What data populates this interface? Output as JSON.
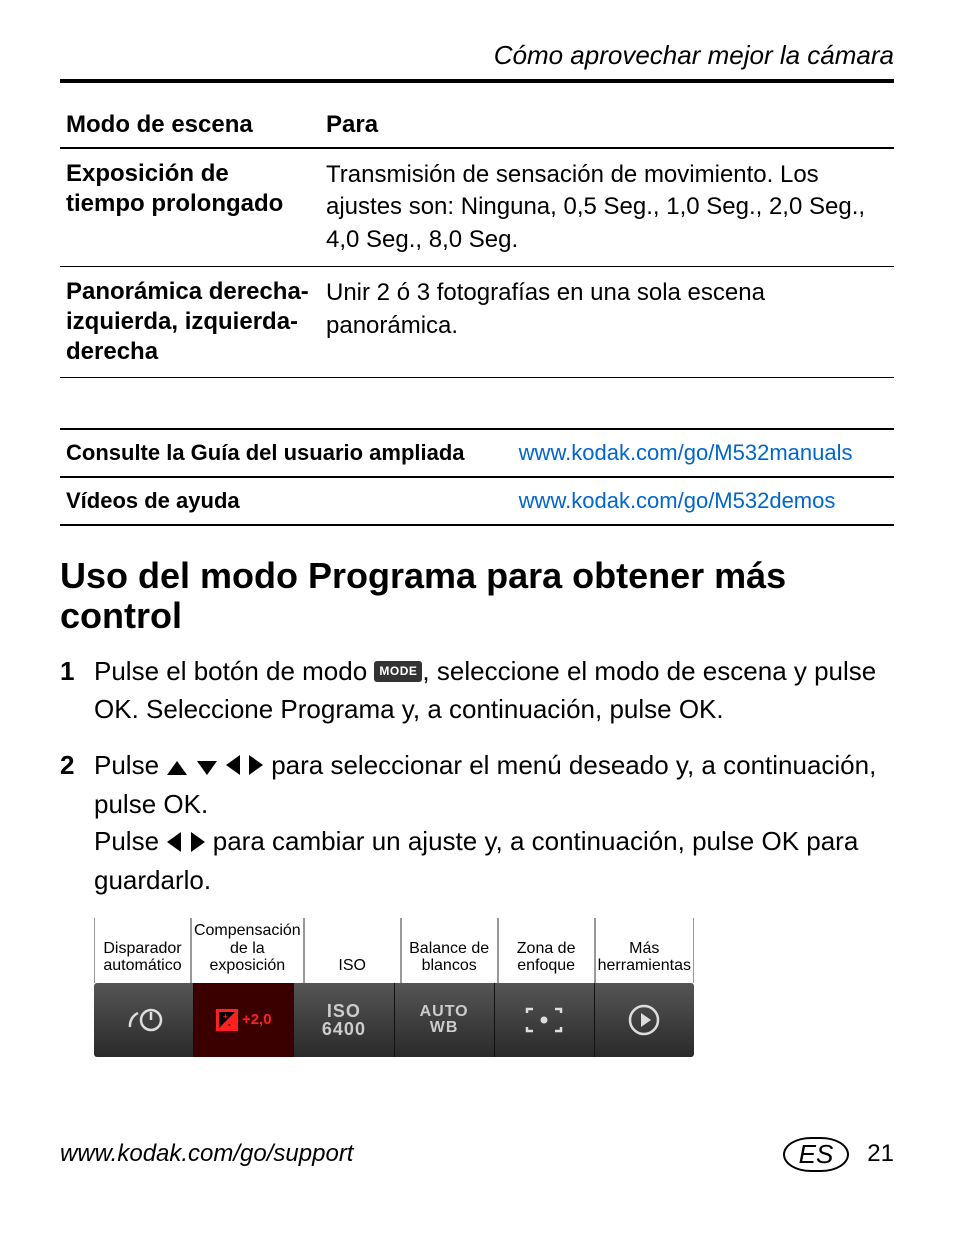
{
  "header": {
    "running_head": "Cómo aprovechar mejor la cámara"
  },
  "scene_table": {
    "col1": "Modo de escena",
    "col2": "Para",
    "rows": [
      {
        "mode": "Exposición de tiempo prolongado",
        "desc": "Transmisión de sensación de movimiento. Los ajustes son: Ninguna, 0,5 Seg., 1,0 Seg., 2,0 Seg., 4,0 Seg., 8,0 Seg."
      },
      {
        "mode": "Panorámica derecha-izquierda, izquierda-derecha",
        "desc": "Unir 2 ó 3 fotografías en una sola escena panorámica."
      }
    ]
  },
  "links_table": {
    "rows": [
      {
        "label": "Consulte la Guía del usuario ampliada",
        "url": "www.kodak.com/go/M532manuals"
      },
      {
        "label": "Vídeos de ayuda",
        "url": "www.kodak.com/go/M532demos"
      }
    ]
  },
  "section_title": "Uso del modo Programa para obtener más control",
  "steps": {
    "s1_a": "Pulse el botón de modo ",
    "s1_mode_badge": "MODE",
    "s1_b": ", seleccione el modo de escena y pulse OK. Seleccione Programa y, a continuación, pulse OK.",
    "s2_a": "Pulse ",
    "s2_b": " para seleccionar el menú deseado y, a continuación, pulse OK.",
    "s2_c": "Pulse ",
    "s2_d": " para cambiar un ajuste y, a continuación, pulse OK para guardarlo."
  },
  "toolbar": {
    "labels": [
      "Disparador automático",
      "Compensación de la exposición",
      "ISO",
      "Balance de blancos",
      "Zona de enfoque",
      "Más herramientas"
    ],
    "exp_value": "+2,0",
    "iso_line1": "ISO",
    "iso_line2": "6400",
    "wb_line1": "AUTO",
    "wb_line2": "WB"
  },
  "footer": {
    "url": "www.kodak.com/go/support",
    "lang_badge": "ES",
    "page_num": "21"
  }
}
